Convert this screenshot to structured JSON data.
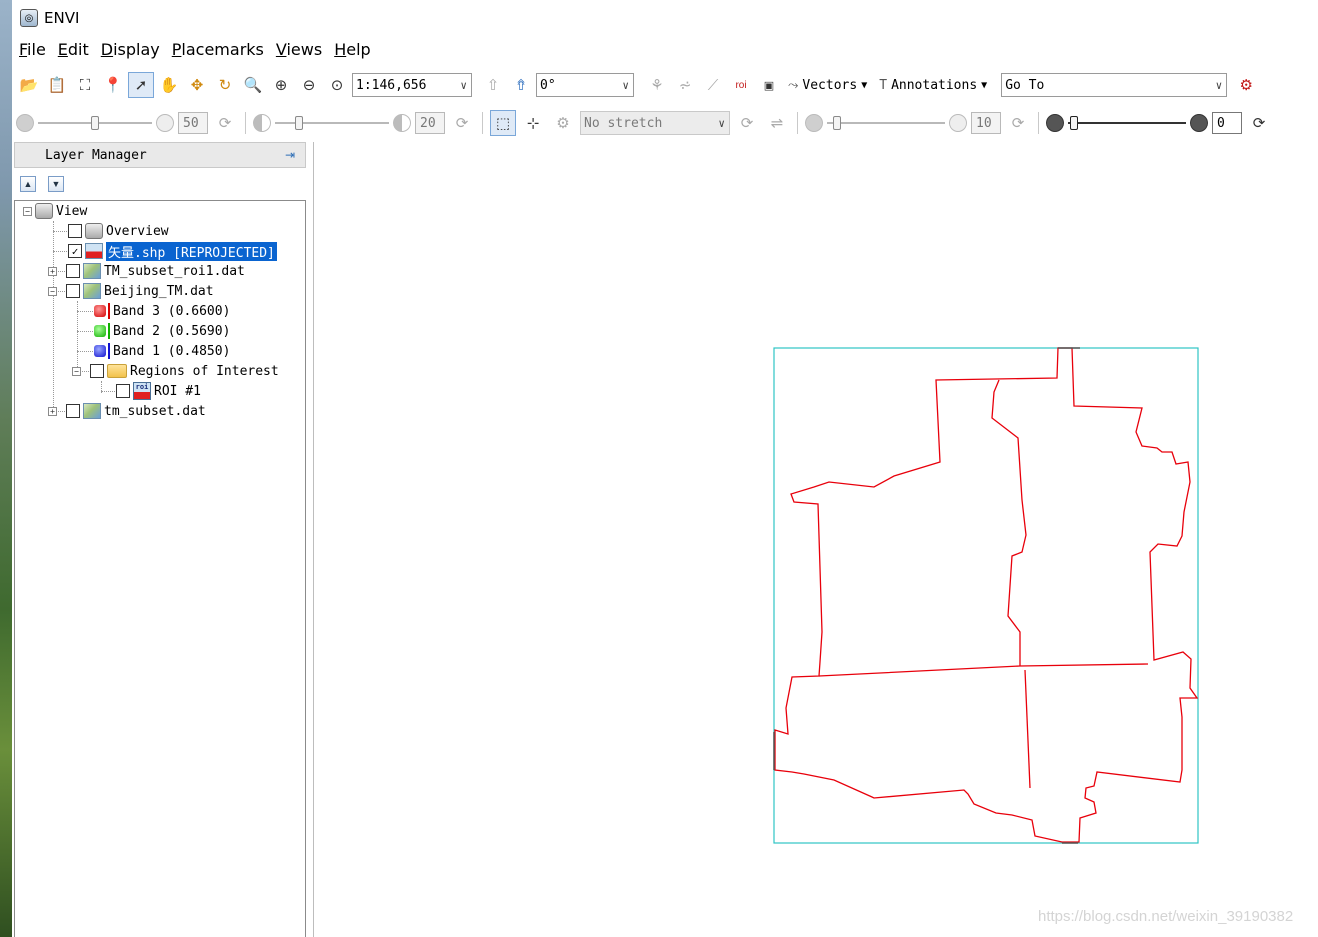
{
  "window": {
    "title": "ENVI"
  },
  "menu": [
    "File",
    "Edit",
    "Display",
    "Placemarks",
    "Views",
    "Help"
  ],
  "toolbar": {
    "scale_value": "1:146,656",
    "rotation_value": "0°",
    "vectors_label": "Vectors",
    "annotations_label": "Annotations",
    "goto_value": "Go To"
  },
  "toolbar2": {
    "brightness_value": "50",
    "contrast_value": "20",
    "stretch_value": "No stretch",
    "sharpen_value": "10",
    "transparency_value": "0"
  },
  "layer_manager": {
    "title": "Layer Manager",
    "tree": {
      "view": "View",
      "overview": "Overview",
      "vector_layer": "矢量.shp [REPROJECTED]",
      "tm_subset_roi": "TM_subset_roi1.dat",
      "beijing_tm": "Beijing_TM.dat",
      "band3": "Band 3 (0.6600)",
      "band2": "Band 2 (0.5690)",
      "band1": "Band 1 (0.4850)",
      "roi_folder": "Regions of Interest",
      "roi1": "ROI #1",
      "tm_subset": "tm_subset.dat"
    }
  },
  "icons": {
    "roi_tag": "roi",
    "sat_tag": "roi"
  },
  "colors": {
    "selection": "#0a64d0",
    "vector_outline": "#e8000b",
    "extent_box": "#2ec4c4"
  },
  "watermark": "https://blog.csdn.net/weixin_39190382"
}
